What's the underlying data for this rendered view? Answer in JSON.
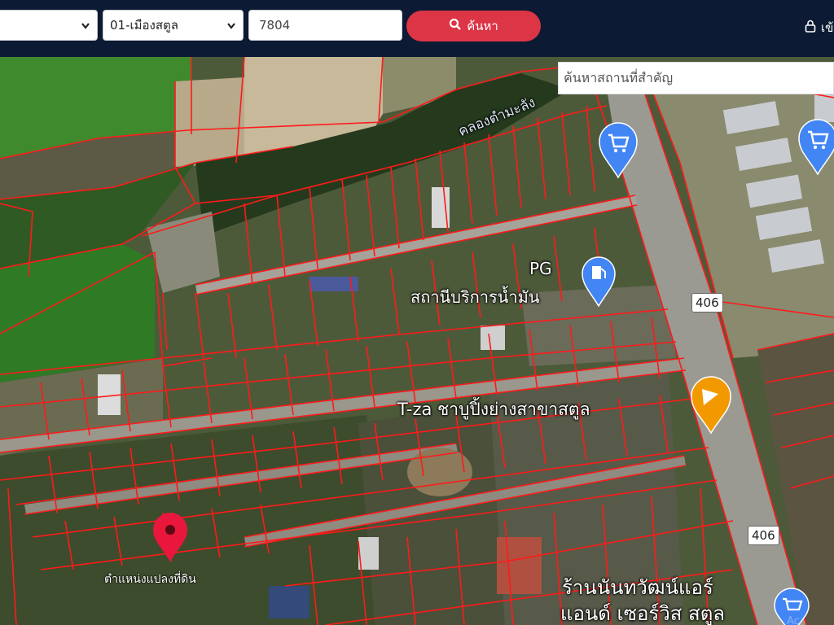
{
  "search": {
    "province_value": "",
    "district_value": "01-เมืองสตูล",
    "parcel_value": "7804",
    "button_label": "ค้นหา",
    "login_label": "เข้"
  },
  "map": {
    "place_search_placeholder": "ค้นหาสถานที่สำคัญ",
    "labels": {
      "poi_gas_name": "PG",
      "poi_gas_type": "สถานีบริการน้ำมัน",
      "poi_restaurant": "T-za ชาบูปิ้งย่างสาขาสตูล",
      "poi_shop_line1": "ร้านนันทวัฒน์แอร์",
      "poi_shop_line2": "แอนด์ เซอร์วิส สตูล",
      "canal": "คลองตำมะลัง",
      "road_406_a": "406",
      "road_406_b": "406",
      "parcel_pin": "ตำแหน่งแปลงที่ดิน",
      "watermark": "Ac"
    },
    "colors": {
      "parcel_line": "#ff1a1a",
      "pin": "#e8173b",
      "poi_blue": "#4285f4",
      "poi_orange": "#f29900"
    },
    "icons": [
      "chevron-down-icon",
      "search-icon",
      "lock-icon",
      "map-pin-icon",
      "shopping-cart-icon",
      "fuel-station-icon",
      "restaurant-icon"
    ]
  }
}
